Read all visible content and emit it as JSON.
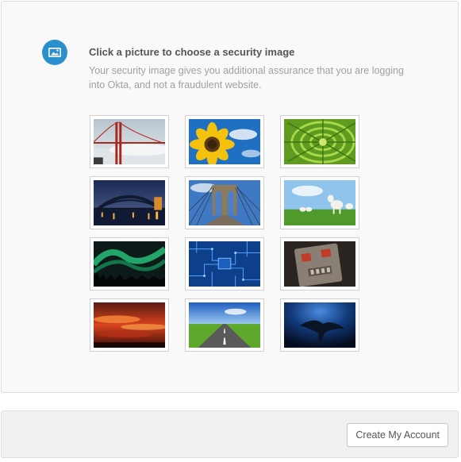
{
  "header": {
    "title": "Click a picture to choose a security image",
    "description": "Your security image gives you additional assurance that you are logging into Okta, and not a fraudulent website.",
    "icon": "image-icon"
  },
  "security_images": [
    {
      "name": "golden-gate-bridge"
    },
    {
      "name": "sunflower"
    },
    {
      "name": "succulent-plant"
    },
    {
      "name": "sydney-harbour-bridge"
    },
    {
      "name": "brooklyn-bridge"
    },
    {
      "name": "sheep-in-field"
    },
    {
      "name": "aurora-borealis"
    },
    {
      "name": "circuit-board"
    },
    {
      "name": "robot"
    },
    {
      "name": "red-sunset-sky"
    },
    {
      "name": "road-to-horizon"
    },
    {
      "name": "manta-ray"
    }
  ],
  "footer": {
    "create_button_label": "Create My Account"
  },
  "colors": {
    "accent": "#2b8fce"
  }
}
